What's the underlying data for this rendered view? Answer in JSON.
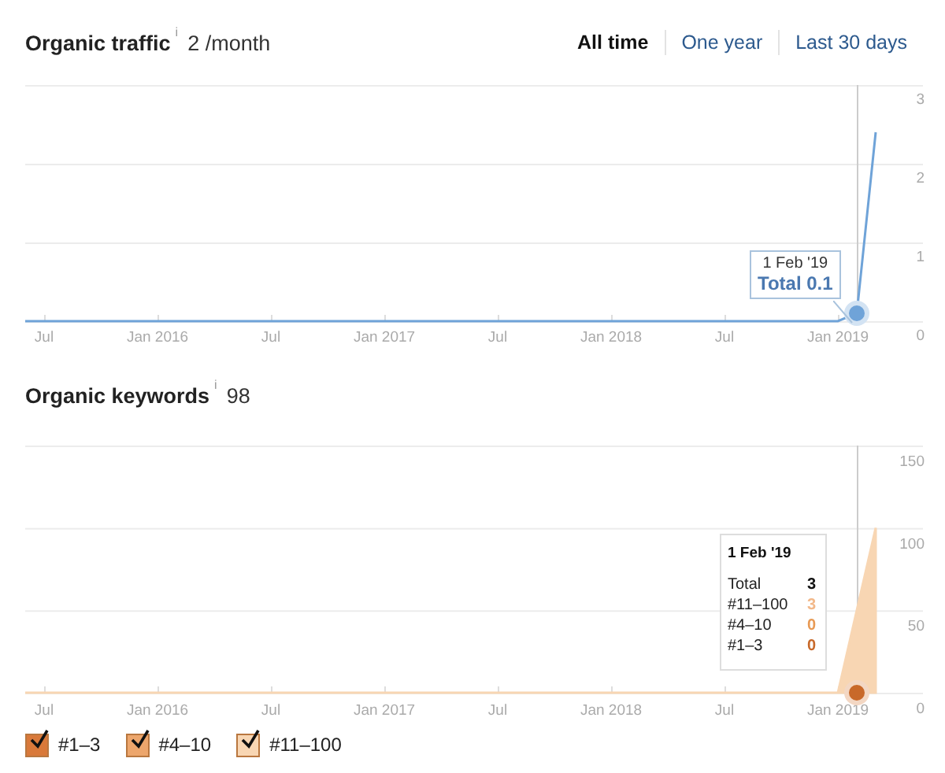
{
  "traffic": {
    "title": "Organic traffic",
    "info_mark": "i",
    "value": "2 /month",
    "ranges": [
      {
        "label": "All time",
        "selected": true
      },
      {
        "label": "One year",
        "selected": false
      },
      {
        "label": "Last 30 days",
        "selected": false
      }
    ],
    "tooltip": {
      "date": "1 Feb '19",
      "total": "Total 0.1"
    },
    "chart_data": {
      "type": "line",
      "categories": [
        null,
        "Jul",
        null,
        null,
        null,
        null,
        null,
        "Jan 2016",
        null,
        null,
        null,
        null,
        null,
        "Jul",
        null,
        null,
        null,
        null,
        null,
        "Jan 2017",
        null,
        null,
        null,
        null,
        null,
        "Jul",
        null,
        null,
        null,
        null,
        null,
        "Jan 2018",
        null,
        null,
        null,
        null,
        null,
        "Jul",
        null,
        null,
        null,
        null,
        null,
        "Jan 2019",
        null,
        null
      ],
      "series": [
        {
          "color": "#6fa3d8",
          "values": [
            0,
            0,
            0,
            0,
            0,
            0,
            0,
            0,
            0,
            0,
            0,
            0,
            0,
            0,
            0,
            0,
            0,
            0,
            0,
            0,
            0,
            0,
            0,
            0,
            0,
            0,
            0,
            0,
            0,
            0,
            0,
            0,
            0,
            0,
            0,
            0,
            0,
            0,
            0,
            0,
            0,
            0,
            0,
            0,
            0.1,
            2.4
          ]
        }
      ],
      "ylim": [
        0,
        3
      ],
      "yticks": [
        0,
        1,
        2,
        3
      ]
    }
  },
  "keywords": {
    "title": "Organic keywords",
    "info_mark": "i",
    "value": "98",
    "tooltip": {
      "date": "1 Feb '19",
      "rows": [
        {
          "label": "Total",
          "value": "3",
          "color": "#111111"
        },
        {
          "label": "#11–100",
          "value": "3",
          "color": "#f2b889"
        },
        {
          "label": "#4–10",
          "value": "0",
          "color": "#e89a55"
        },
        {
          "label": "#1–3",
          "value": "0",
          "color": "#c8692a"
        }
      ]
    },
    "chart_data": {
      "type": "area",
      "categories": [
        null,
        "Jul",
        null,
        null,
        null,
        null,
        null,
        "Jan 2016",
        null,
        null,
        null,
        null,
        null,
        "Jul",
        null,
        null,
        null,
        null,
        null,
        "Jan 2017",
        null,
        null,
        null,
        null,
        null,
        "Jul",
        null,
        null,
        null,
        null,
        null,
        "Jan 2018",
        null,
        null,
        null,
        null,
        null,
        "Jul",
        null,
        null,
        null,
        null,
        null,
        "Jan 2019",
        null,
        null
      ],
      "series": [
        {
          "color": "#f8d6b3",
          "values": [
            0,
            0,
            0,
            0,
            0,
            0,
            0,
            0,
            0,
            0,
            0,
            0,
            0,
            0,
            0,
            0,
            0,
            0,
            0,
            0,
            0,
            0,
            0,
            0,
            0,
            0,
            0,
            0,
            0,
            0,
            0,
            0,
            0,
            0,
            0,
            0,
            0,
            0,
            0,
            0,
            0,
            0,
            0,
            0,
            null,
            100
          ]
        }
      ],
      "ylim": [
        0,
        150
      ],
      "yticks": [
        0,
        50,
        100,
        150
      ]
    },
    "legend": [
      {
        "label": "#1–3",
        "checked": true,
        "color": "#d9793a"
      },
      {
        "label": "#4–10",
        "checked": true,
        "color": "#eda66c"
      },
      {
        "label": "#11–100",
        "checked": true,
        "color": "#f8d6b3"
      }
    ]
  }
}
